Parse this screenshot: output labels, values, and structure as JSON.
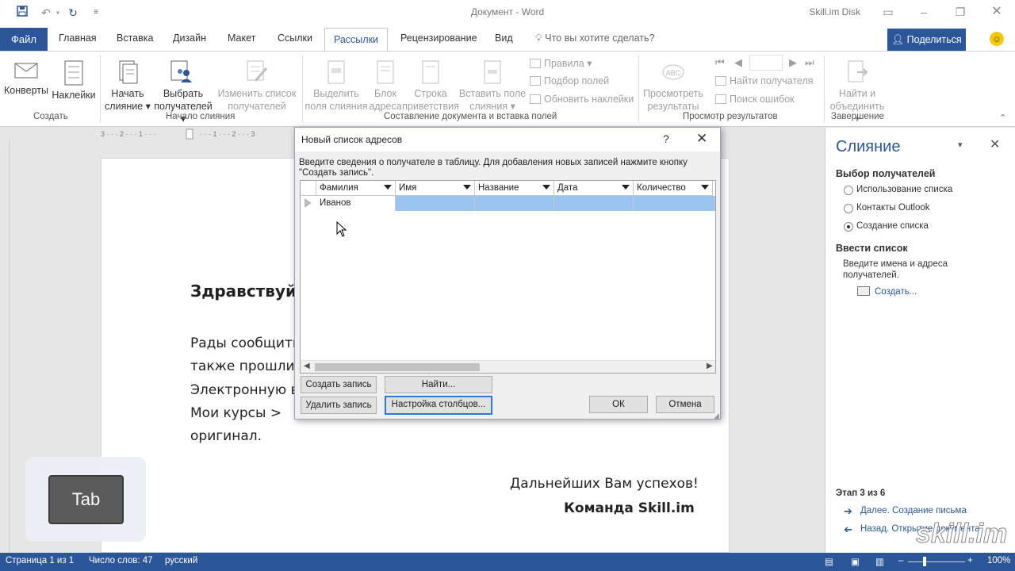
{
  "window": {
    "doc_title": "Документ  -  Word",
    "user": "Skill.im Disk"
  },
  "tabs": {
    "file": "Файл",
    "items": [
      "Главная",
      "Вставка",
      "Дизайн",
      "Макет",
      "Ссылки",
      "Рассылки",
      "Рецензирование",
      "Вид"
    ],
    "active": "Рассылки",
    "tell_me": "Что вы хотите сделать?",
    "share": "Поделиться"
  },
  "ribbon": {
    "envelopes": "Конверты",
    "labels": "Наклейки",
    "start_merge_1": "Начать",
    "start_merge_2": "слияние",
    "select_recipients_1": "Выбрать",
    "select_recipients_2": "получателей",
    "edit_list_1": "Изменить список",
    "edit_list_2": "получателей",
    "highlight_fields_1": "Выделить",
    "highlight_fields_2": "поля слияния",
    "address_block_1": "Блок",
    "address_block_2": "адреса",
    "greeting_line_1": "Строка",
    "greeting_line_2": "приветствия",
    "insert_field_1": "Вставить поле",
    "insert_field_2": "слияния",
    "rules": "Правила",
    "match_fields": "Подбор полей",
    "update_labels": "Обновить наклейки",
    "preview_1": "Просмотреть",
    "preview_2": "результаты",
    "find_recipient": "Найти получателя",
    "check_errors": "Поиск ошибок",
    "finish_1": "Найти и",
    "finish_2": "объединить",
    "groups": {
      "create": "Создать",
      "start": "Начало слияния",
      "compose": "Составление документа и вставка полей",
      "preview": "Просмотр результатов",
      "finish": "Завершение"
    }
  },
  "document": {
    "greeting": "Здравствуй",
    "line1": "Рады сообщить,",
    "line2": "также прошли с",
    "line3": "Электронную ве",
    "line4": "Мои  курсы  >",
    "line5": "оригинал.",
    "closing1": "Дальнейших Вам успехов!",
    "closing2": "Команда Skill.im"
  },
  "pane": {
    "title": "Слияние",
    "section1": "Выбор получателей",
    "options": [
      "Использование списка",
      "Контакты Outlook",
      "Создание списка"
    ],
    "selected_index": 2,
    "section2": "Ввести список",
    "hint": "Введите имена и адреса получателей.",
    "create_link": "Создать...",
    "step": "Этап 3 из 6",
    "next": "Далее. Создание письма",
    "back": "Назад. Открытие документа"
  },
  "dialog": {
    "title": "Новый список адресов",
    "help": "?",
    "instruction": "Введите сведения о получателе в таблицу. Для добавления новых записей нажмите кнопку \"Создать запись\".",
    "columns": [
      "Фамилия",
      "Имя",
      "Название",
      "Дата",
      "Количество"
    ],
    "rows": [
      [
        "Иванов",
        "",
        "",
        "",
        ""
      ]
    ],
    "btn_new": "Создать запись",
    "btn_find": "Найти...",
    "btn_delete": "Удалить запись",
    "btn_columns": "Настройка столбцов...",
    "btn_ok": "ОК",
    "btn_cancel": "Отмена"
  },
  "status": {
    "page": "Страница 1 из 1",
    "words": "Число слов: 47",
    "lang": "русский",
    "zoom": "100%"
  },
  "overlay": {
    "key": "Tab",
    "watermark": "skill.im"
  }
}
